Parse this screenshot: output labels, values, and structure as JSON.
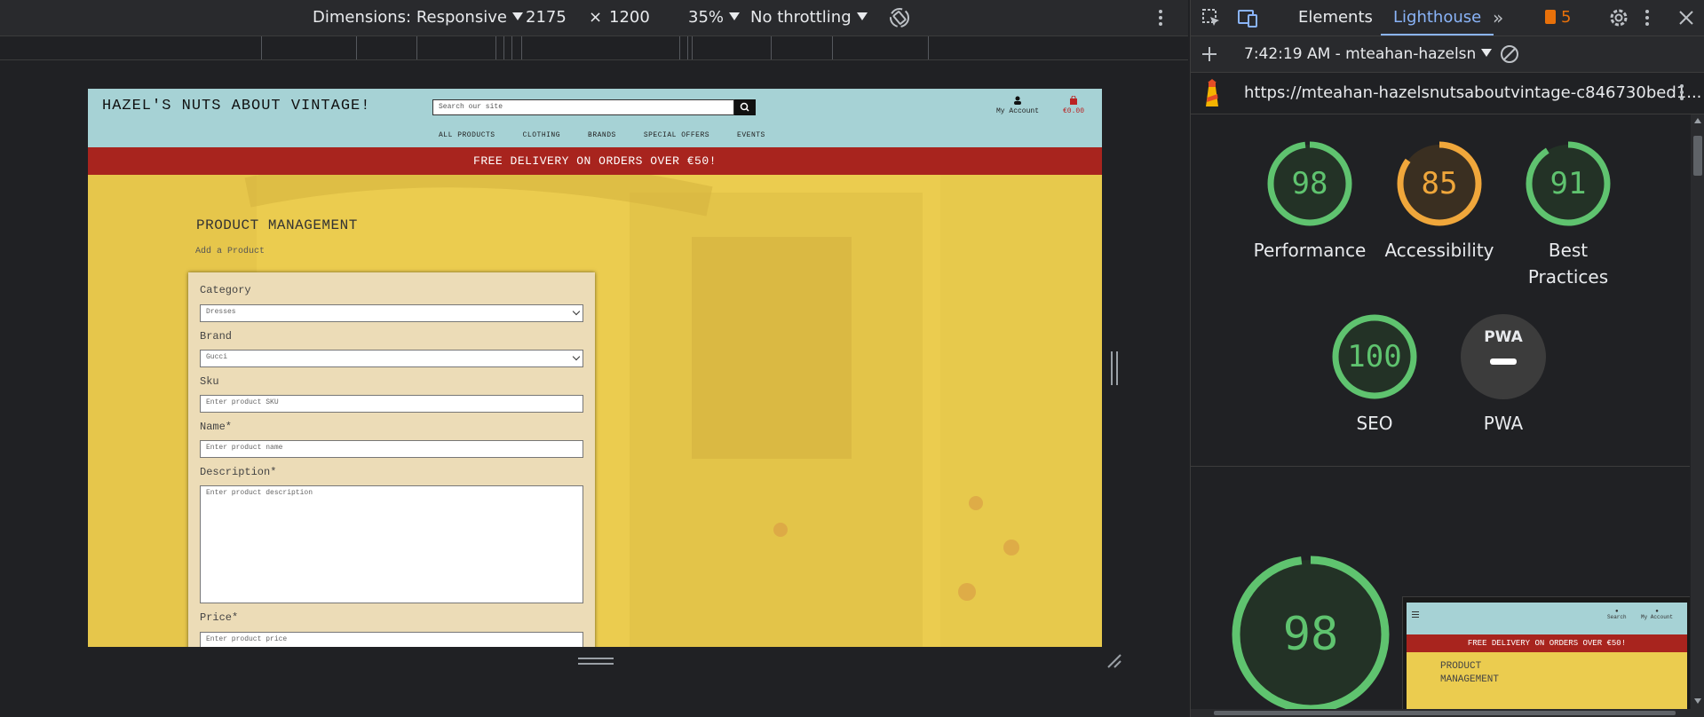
{
  "device_toolbar": {
    "dimensions_label": "Dimensions: Responsive",
    "width": "2175",
    "times": "×",
    "height": "1200",
    "zoom": "35%",
    "throttling": "No throttling"
  },
  "site": {
    "logo": "HAZEL'S NUTS ABOUT VINTAGE!",
    "search_placeholder": "Search our site",
    "account_label": "My Account",
    "bag_total": "€0.00",
    "nav": [
      "ALL PRODUCTS",
      "CLOTHING",
      "BRANDS",
      "SPECIAL OFFERS",
      "EVENTS"
    ],
    "banner": "FREE DELIVERY ON ORDERS OVER €50!",
    "page_title": "PRODUCT MANAGEMENT",
    "page_subtitle": "Add a Product",
    "form": {
      "category_label": "Category",
      "category_value": "Dresses",
      "brand_label": "Brand",
      "brand_value": "Gucci",
      "sku_label": "Sku",
      "sku_placeholder": "Enter product SKU",
      "name_label": "Name*",
      "name_placeholder": "Enter product name",
      "description_label": "Description*",
      "description_placeholder": "Enter product description",
      "price_label": "Price*",
      "price_placeholder": "Enter product price"
    }
  },
  "devtools": {
    "tabs": {
      "elements": "Elements",
      "lighthouse": "Lighthouse",
      "issues_count": "5"
    },
    "session": "7:42:19 AM - mteahan-hazelsn",
    "url": "https://mteahan-hazelsnutsaboutvintage-c846730bed1...",
    "scores": [
      {
        "label": "Performance",
        "value": "98",
        "fraction": 0.98,
        "color": "#5fc36f",
        "bg": "#233226"
      },
      {
        "label": "Accessibility",
        "value": "85",
        "fraction": 0.85,
        "color": "#f0a73b",
        "bg": "#3a2f21"
      },
      {
        "label": "Best Practices",
        "value": "91",
        "fraction": 0.91,
        "color": "#5fc36f",
        "bg": "#233226"
      },
      {
        "label": "SEO",
        "value": "100",
        "fraction": 1.0,
        "color": "#5fc36f",
        "bg": "#233226"
      },
      {
        "label": "PWA",
        "value": "PWA",
        "color": "#e8eaed",
        "bg": "#3c3c3c"
      }
    ],
    "big_score": {
      "value": "98",
      "fraction": 0.98,
      "color": "#5fc36f"
    },
    "thumbnail": {
      "search_label": "Search",
      "account_label": "My Account",
      "banner": "FREE DELIVERY ON ORDERS OVER €50!",
      "title_line1": "PRODUCT",
      "title_line2": "MANAGEMENT"
    }
  }
}
